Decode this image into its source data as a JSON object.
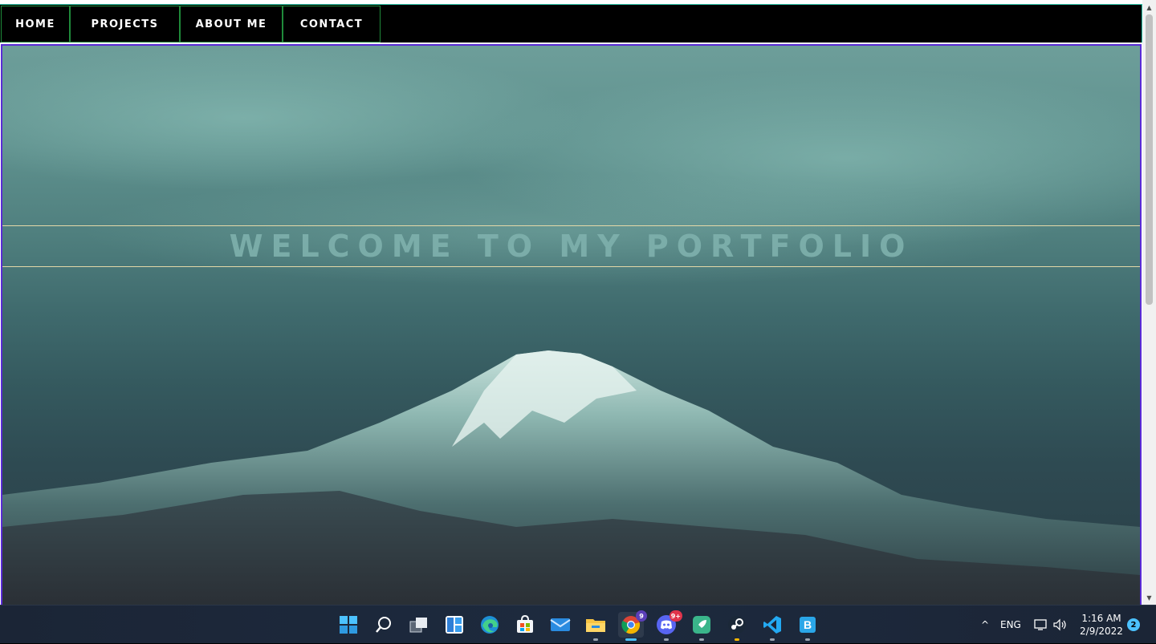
{
  "nav": {
    "items": [
      {
        "label": "Home"
      },
      {
        "label": "Projects"
      },
      {
        "label": "About me"
      },
      {
        "label": "Contact"
      }
    ]
  },
  "hero": {
    "title": "WELCOME TO MY PORTFOLIO"
  },
  "taskbar": {
    "apps": [
      {
        "name": "start-icon"
      },
      {
        "name": "search-icon"
      },
      {
        "name": "task-view-icon"
      },
      {
        "name": "widgets-icon"
      },
      {
        "name": "edge-icon"
      },
      {
        "name": "store-icon"
      },
      {
        "name": "mail-icon"
      },
      {
        "name": "file-explorer-icon"
      },
      {
        "name": "chrome-icon",
        "badge": "9"
      },
      {
        "name": "discord-icon",
        "badge": "9+"
      },
      {
        "name": "rocket-launcher-icon"
      },
      {
        "name": "steam-icon"
      },
      {
        "name": "vscode-icon"
      },
      {
        "name": "app-b-icon"
      }
    ],
    "tray": {
      "language": "ENG",
      "time": "1:16 AM",
      "date": "2/9/2022",
      "notifications": "2"
    }
  },
  "colors": {
    "nav_bg": "#000000",
    "nav_border": "#1f8a3a",
    "hero_border": "#5a2bd6",
    "banner_line": "#e4d9a8",
    "taskbar_bg": "#1d2a3e"
  }
}
